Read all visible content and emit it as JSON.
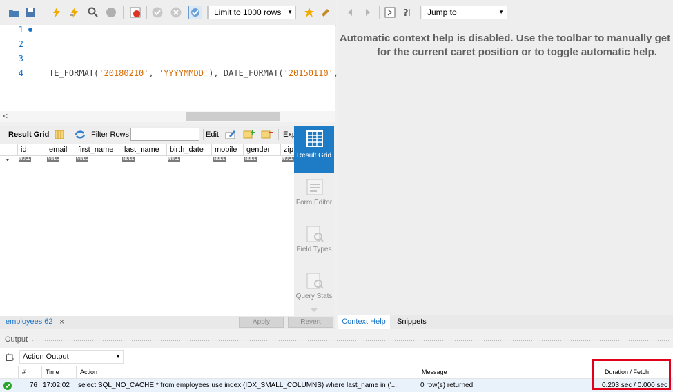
{
  "toolbar": {
    "limit_label": "Limit to 1000 rows",
    "jump_to_label": "Jump to"
  },
  "editor": {
    "line_numbers": [
      "1",
      "2",
      "3",
      "4"
    ],
    "code_line4": {
      "part1": "TE_FORMAT(",
      "str1": "'20180210'",
      "part2": ", ",
      "str2": "'YYYYMMDD'",
      "part3": "), DATE_FORMAT(",
      "str3": "'20150110'",
      "part4": ","
    }
  },
  "result_grid": {
    "title": "Result Grid",
    "filter_label": "Filter Rows:",
    "filter_value": "",
    "edit_label": "Edit:",
    "export_label": "Exp",
    "columns": [
      "id",
      "email",
      "first_name",
      "last_name",
      "birth_date",
      "mobile",
      "gender",
      "zip"
    ],
    "null_text": "NULL",
    "row_marker": "*"
  },
  "side_panel": {
    "result_grid": "Result Grid",
    "form_editor": "Form Editor",
    "field_types": "Field Types",
    "query_stats": "Query Stats"
  },
  "bottom_bar": {
    "tab_label": "employees 62",
    "apply_label": "Apply",
    "revert_label": "Revert"
  },
  "help": {
    "text": "Automatic context help is disabled. Use the toolbar to manually get help for the current caret position or to toggle automatic help.",
    "tab_context_help": "Context Help",
    "tab_snippets": "Snippets"
  },
  "output": {
    "title": "Output",
    "mode": "Action Output",
    "headers": [
      "#",
      "Time",
      "Action",
      "Message",
      "Duration / Fetch"
    ],
    "row": {
      "index": "76",
      "time": "17:02:02",
      "action": "select SQL_NO_CACHE * from employees use index (IDX_SMALL_COLUMNS) where  last_name in ('...",
      "message": "0 row(s) returned",
      "duration": "0.203 sec / 0.000 sec"
    }
  },
  "colors": {
    "accent": "#1a73c8",
    "side_active": "#1e7bc6",
    "highlight_box": "#e0001b",
    "success": "#2aa52a"
  }
}
